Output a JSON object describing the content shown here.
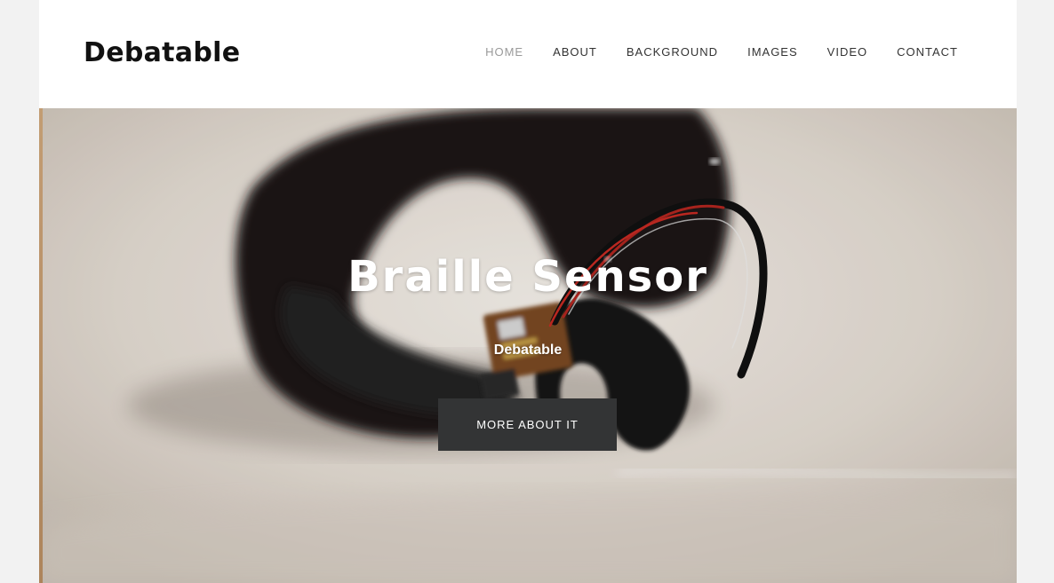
{
  "site": {
    "logo": "Debatable"
  },
  "nav": {
    "items": [
      {
        "label": "HOME",
        "active": true
      },
      {
        "label": "ABOUT",
        "active": false
      },
      {
        "label": "BACKGROUND",
        "active": false
      },
      {
        "label": "IMAGES",
        "active": false
      },
      {
        "label": "VIDEO",
        "active": false
      },
      {
        "label": "CONTACT",
        "active": false
      }
    ]
  },
  "hero": {
    "title": "Braille Sensor",
    "subtitle": "Debatable",
    "button_label": "MORE ABOUT IT",
    "image_subject": "black fabric finger strap with small circuit board and wires"
  },
  "colors": {
    "background": "#f2f2f2",
    "header": "#ffffff",
    "logo_text": "#111111",
    "nav_text": "#333333",
    "nav_active": "#9a9a9a",
    "button_bg": "#333435",
    "hero_text": "#ffffff"
  }
}
